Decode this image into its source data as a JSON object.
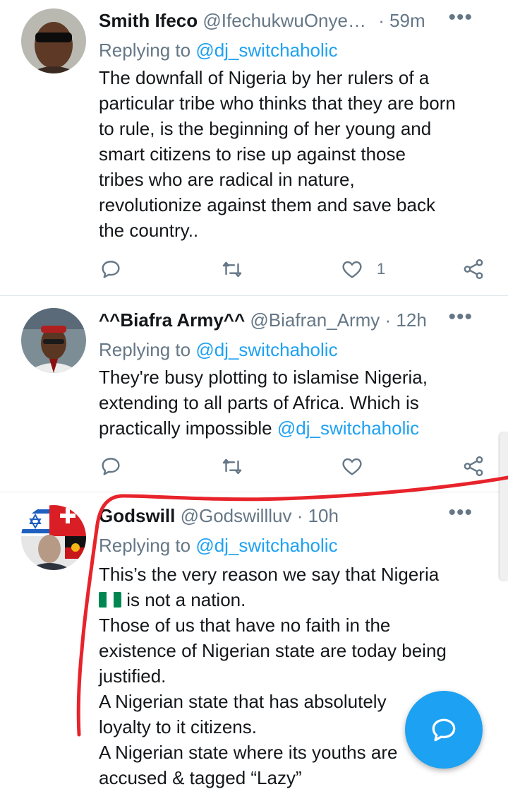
{
  "tweets": [
    {
      "name": "Smith Ifeco",
      "handle": "@IfechukwuOnye…",
      "time": "· 59m",
      "replying_prefix": "Replying to",
      "replying_to": "@dj_switchaholic",
      "text_lines": [
        "The downfall of Nigeria by her rulers of a",
        "particular tribe who thinks that they are born",
        "to rule, is the beginning of her young and",
        "smart citizens to rise up against those",
        "tribes who are radical in nature,",
        "revolutionize against them and save back",
        "the country.."
      ],
      "like_count": "1"
    },
    {
      "name": "^^Biafra Army^^",
      "handle": "@Biafran_Army",
      "time": "· 12h",
      "replying_prefix": "Replying to",
      "replying_to": "@dj_switchaholic",
      "text_lines": [
        "They're busy plotting to islamise Nigeria,",
        "extending to all parts of Africa. Which is",
        "practically impossible "
      ],
      "text_mention": "@dj_switchaholic",
      "like_count": ""
    },
    {
      "name": "Godswill",
      "handle": "@Godswillluv",
      "time": "· 10h",
      "replying_prefix": "Replying to",
      "replying_to": "@dj_switchaholic",
      "text_lines": [
        "This’s the very reason we say that Nigeria",
        " is not a nation.",
        "Those of us that have no faith in the",
        "existence of Nigerian state are today being",
        "justified.",
        "A Nigerian state that has absolutely",
        "loyalty to it citizens.",
        "A Nigerian state where its youths are",
        "accused & tagged “Lazy”"
      ]
    }
  ],
  "more_glyph": "•••",
  "colors": {
    "accent": "#1da1f2",
    "muted": "#657786",
    "text": "#14171a",
    "divider": "#e1e8ed",
    "annotation": "#e8232b"
  },
  "icons": [
    "reply-icon",
    "retweet-icon",
    "like-icon",
    "share-icon",
    "compose-reply-icon"
  ]
}
